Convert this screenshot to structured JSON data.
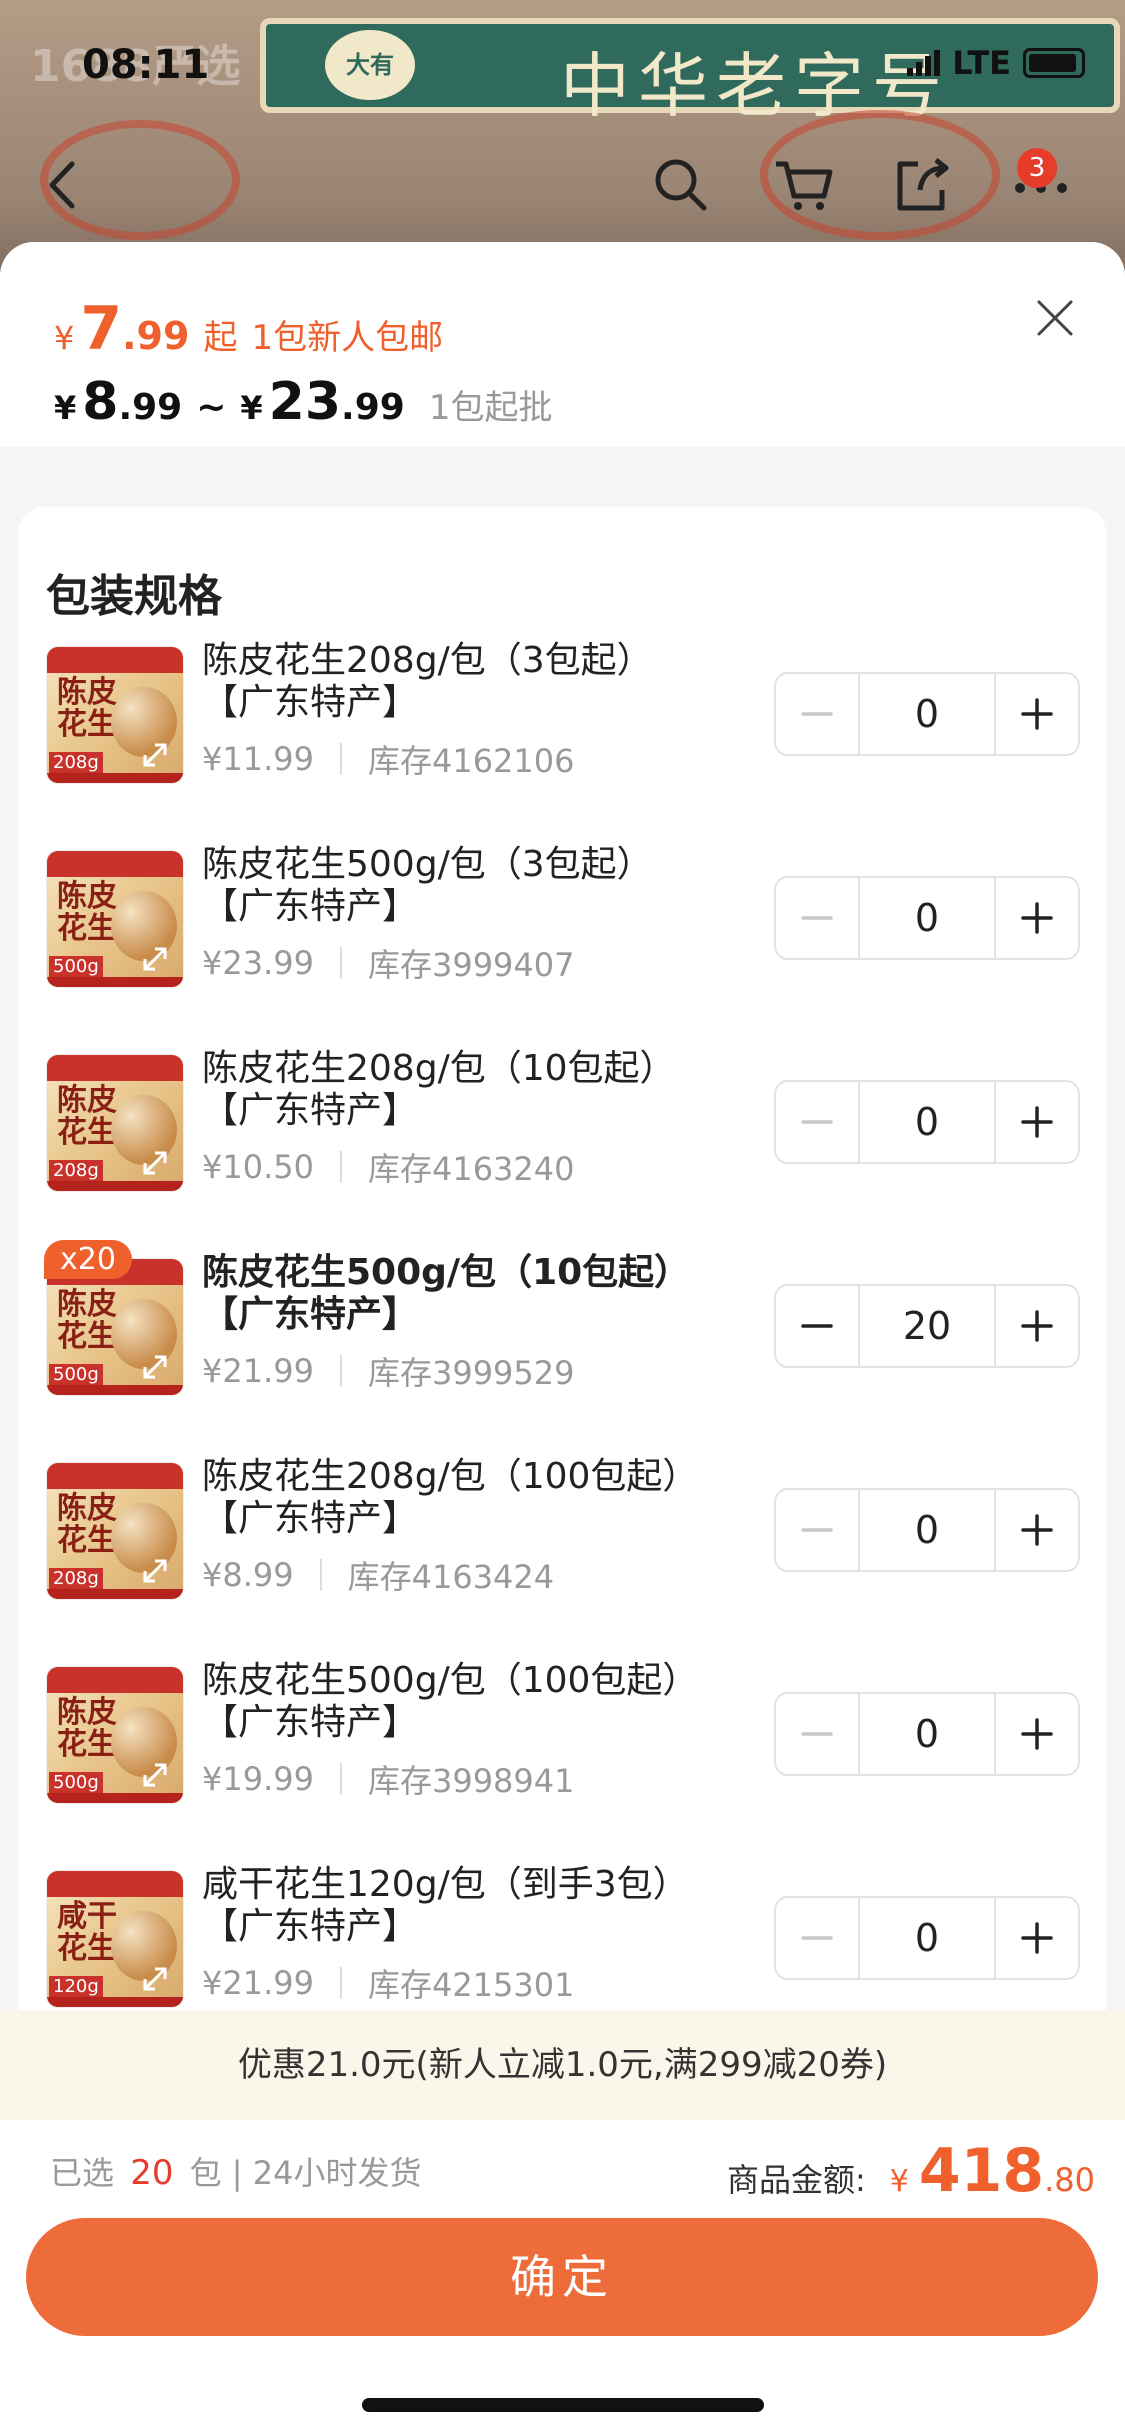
{
  "status_bar": {
    "time": "08:11",
    "network": "LTE"
  },
  "background": {
    "ghost_text": "1688严选",
    "logo_text": "大有",
    "banner_text": "中华老字号"
  },
  "header": {
    "cart_badge": "3"
  },
  "price": {
    "yen": "¥",
    "start_int": "7",
    "start_dec": ".99",
    "start_suffix": "起",
    "start_note": "1包新人包邮",
    "range_low_int": "8",
    "range_low_dec": ".99",
    "range_sep": "~",
    "range_high_int": "23",
    "range_high_dec": ".99",
    "min_order": "1包起批"
  },
  "section_title": "包装规格",
  "items": [
    {
      "name_line1": "陈皮花生208g/包（3包起）",
      "name_line2": "【广东特产】",
      "price": "¥11.99",
      "stock": "库存4162106",
      "qty": "0",
      "weight": "208g",
      "thumb_text": "陈皮花生"
    },
    {
      "name_line1": "陈皮花生500g/包（3包起）",
      "name_line2": "【广东特产】",
      "price": "¥23.99",
      "stock": "库存3999407",
      "qty": "0",
      "weight": "500g",
      "thumb_text": "陈皮花生"
    },
    {
      "name_line1": "陈皮花生208g/包（10包起）",
      "name_line2": "【广东特产】",
      "price": "¥10.50",
      "stock": "库存4163240",
      "qty": "0",
      "weight": "208g",
      "thumb_text": "陈皮花生"
    },
    {
      "name_line1": "陈皮花生500g/包（10包起）",
      "name_line2": "【广东特产】",
      "price": "¥21.99",
      "stock": "库存3999529",
      "qty": "20",
      "weight": "500g",
      "thumb_text": "陈皮花生",
      "badge": "x20"
    },
    {
      "name_line1": "陈皮花生208g/包（100包起）",
      "name_line2": "【广东特产】",
      "price": "¥8.99",
      "stock": "库存4163424",
      "qty": "0",
      "weight": "208g",
      "thumb_text": "陈皮花生"
    },
    {
      "name_line1": "陈皮花生500g/包（100包起）",
      "name_line2": "【广东特产】",
      "price": "¥19.99",
      "stock": "库存3998941",
      "qty": "0",
      "weight": "500g",
      "thumb_text": "陈皮花生"
    },
    {
      "name_line1": "咸干花生120g/包（到手3包）",
      "name_line2": "【广东特产】",
      "price": "¥21.99",
      "stock": "库存4215301",
      "qty": "0",
      "weight": "120g",
      "thumb_text": "咸干花生"
    }
  ],
  "discount_text": "优惠21.0元(新人立减1.0元,满299减20券)",
  "summary": {
    "selected_prefix": "已选",
    "selected_count": "20",
    "selected_suffix": "包 | 24小时发货",
    "amount_label": "商品金额:",
    "amount_yen": "¥",
    "amount_int": "418",
    "amount_dec": ".80"
  },
  "confirm_label": "确定",
  "colors": {
    "accent": "#f0602d",
    "button": "#ee6b3a",
    "badge": "#e63c2a"
  }
}
